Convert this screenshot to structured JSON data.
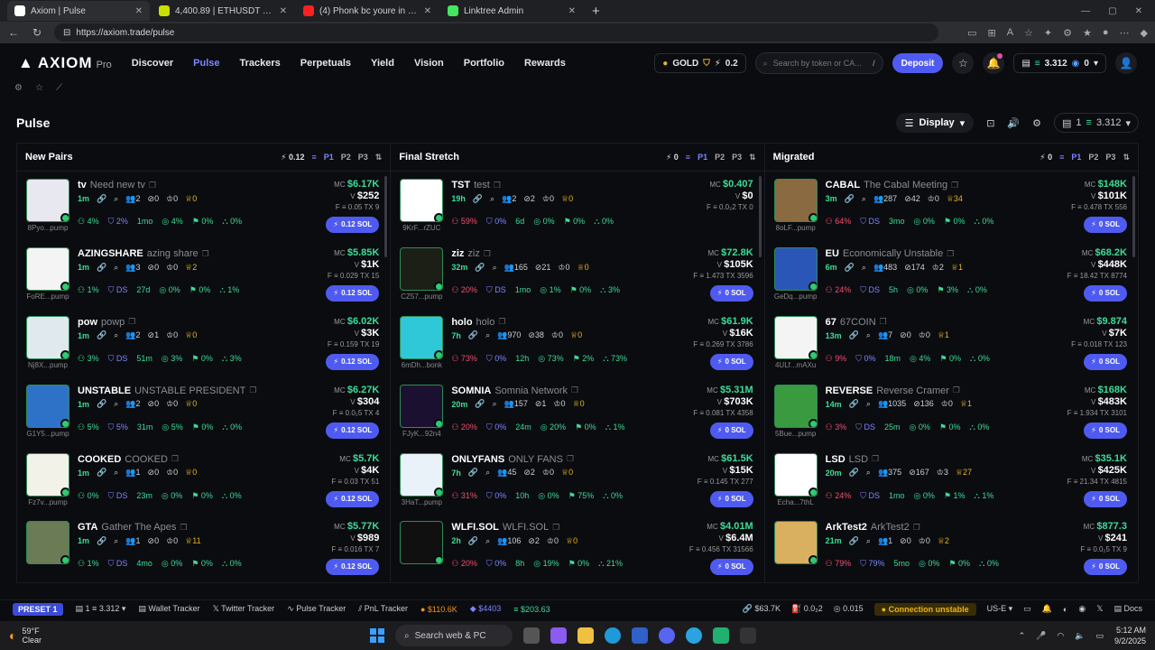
{
  "browser": {
    "tabs": [
      {
        "title": "Axiom | Pulse",
        "color": "#ffffff",
        "active": true
      },
      {
        "title": "4,400.89 | ETHUSDT Futures Exch",
        "color": "#c8e000",
        "active": false
      },
      {
        "title": "(4) Phonk bc youre in an ed",
        "color": "#ff2020",
        "active": false
      },
      {
        "title": "Linktree Admin",
        "color": "#43e660",
        "active": false
      }
    ],
    "url": "https://axiom.trade/pulse"
  },
  "nav": {
    "logo": "AXIOM",
    "logo_sub": "Pro",
    "links": [
      "Discover",
      "Pulse",
      "Trackers",
      "Perpetuals",
      "Yield",
      "Vision",
      "Portfolio",
      "Rewards"
    ],
    "active": "Pulse",
    "gold_label": "GOLD",
    "points": "0.2",
    "search_placeholder": "Search by token or CA...",
    "search_key": "/",
    "deposit": "Deposit",
    "balance": "3.312",
    "usd_balance": "0"
  },
  "page": {
    "title": "Pulse",
    "display": "Display",
    "wallet_count": "1",
    "wallet_balance": "3.312"
  },
  "columns": [
    {
      "title": "New Pairs",
      "amount": "0.12",
      "tokens": [
        {
          "sym": "tv",
          "name": "Need new tv",
          "age": "1m",
          "s1": "2",
          "s2": "0",
          "s3": "0",
          "s4": "0",
          "addr": "8Pyo...pump",
          "mc": "$6.17K",
          "v": "$252",
          "f": "0.05",
          "tx": "9",
          "sol": "0.12 SOL",
          "p1": "4%",
          "p2": "2%",
          "p3": "1mo",
          "p4": "4%",
          "p5": "0%",
          "p6": "0%",
          "thumb": "#e8e8f0"
        },
        {
          "sym": "AZINGSHARE",
          "name": "azing share",
          "age": "1m",
          "s1": "3",
          "s2": "0",
          "s3": "0",
          "s4": "2",
          "addr": "FoRE...pump",
          "mc": "$5.85K",
          "v": "$1K",
          "f": "0.029",
          "tx": "15",
          "sol": "0.12 SOL",
          "p1": "1%",
          "p2": "DS",
          "p3": "27d",
          "p4": "0%",
          "p5": "0%",
          "p6": "1%",
          "thumb": "#f4f4f4"
        },
        {
          "sym": "pow",
          "name": "powp",
          "age": "1m",
          "s1": "2",
          "s2": "1",
          "s3": "0",
          "s4": "0",
          "addr": "Nj8X...pump",
          "mc": "$6.02K",
          "v": "$3K",
          "f": "0.159",
          "tx": "19",
          "sol": "0.12 SOL",
          "p1": "3%",
          "p2": "DS",
          "p3": "51m",
          "p4": "3%",
          "p5": "0%",
          "p6": "3%",
          "thumb": "#dfe9ee"
        },
        {
          "sym": "UNSTABLE",
          "name": "UNSTABLE PRESIDENT",
          "age": "1m",
          "s1": "2",
          "s2": "0",
          "s3": "0",
          "s4": "0",
          "addr": "G1Y5...pump",
          "mc": "$6.27K",
          "v": "$304",
          "f": "0.0₂5",
          "tx": "4",
          "sol": "0.12 SOL",
          "p1": "5%",
          "p2": "5%",
          "p3": "31m",
          "p4": "5%",
          "p5": "0%",
          "p6": "0%",
          "thumb": "#2e72c8"
        },
        {
          "sym": "COOKED",
          "name": "COOKED",
          "age": "1m",
          "s1": "1",
          "s2": "0",
          "s3": "0",
          "s4": "0",
          "addr": "Fz7v...pump",
          "mc": "$5.7K",
          "v": "$4K",
          "f": "0.03",
          "tx": "51",
          "sol": "0.12 SOL",
          "p1": "0%",
          "p2": "DS",
          "p3": "23m",
          "p4": "0%",
          "p5": "0%",
          "p6": "0%",
          "thumb": "#f2f2e8"
        },
        {
          "sym": "GTA",
          "name": "Gather The Apes",
          "age": "1m",
          "s1": "1",
          "s2": "0",
          "s3": "0",
          "s4": "11",
          "addr": "",
          "mc": "$5.77K",
          "v": "$989",
          "f": "0.016",
          "tx": "7",
          "sol": "0.12 SOL",
          "p1": "1%",
          "p2": "DS",
          "p3": "4mo",
          "p4": "0%",
          "p5": "0%",
          "p6": "0%",
          "thumb": "#6a7b55"
        }
      ]
    },
    {
      "title": "Final Stretch",
      "amount": "0",
      "tokens": [
        {
          "sym": "TST",
          "name": "test",
          "age": "19h",
          "s1": "2",
          "s2": "2",
          "s3": "0",
          "s4": "0",
          "addr": "9KrF...rZUC",
          "mc": "$0.407",
          "v": "$0",
          "f": "0.0₂2",
          "tx": "0",
          "sol": "",
          "p1": "59%",
          "p2": "0%",
          "p3": "6d",
          "p4": "0%",
          "p5": "0%",
          "p6": "0%",
          "thumb": "#ffffff"
        },
        {
          "sym": "ziz",
          "name": "ziz",
          "age": "32m",
          "s1": "165",
          "s2": "21",
          "s3": "0",
          "s4": "0",
          "addr": "CZ57...pump",
          "mc": "$72.8K",
          "v": "$105K",
          "f": "1.473",
          "tx": "3596",
          "sol": "0 SOL",
          "p1": "20%",
          "p2": "DS",
          "p3": "1mo",
          "p4": "1%",
          "p5": "0%",
          "p6": "3%",
          "thumb": "#1c1f16"
        },
        {
          "sym": "holo",
          "name": "holo",
          "age": "7h",
          "s1": "970",
          "s2": "38",
          "s3": "0",
          "s4": "0",
          "addr": "6mDh...bonk",
          "mc": "$61.9K",
          "v": "$16K",
          "f": "0.269",
          "tx": "3786",
          "sol": "0 SOL",
          "p1": "73%",
          "p2": "0%",
          "p3": "12h",
          "p4": "73%",
          "p5": "2%",
          "p6": "73%",
          "thumb": "#2fc8d8"
        },
        {
          "sym": "SOMNIA",
          "name": "Somnia Network",
          "age": "20m",
          "s1": "157",
          "s2": "1",
          "s3": "0",
          "s4": "0",
          "addr": "FJyK...92n4",
          "mc": "$5.31M",
          "v": "$703K",
          "f": "0.081",
          "tx": "4358",
          "sol": "0 SOL",
          "p1": "20%",
          "p2": "0%",
          "p3": "24m",
          "p4": "20%",
          "p5": "0%",
          "p6": "1%",
          "thumb": "#1c1030"
        },
        {
          "sym": "ONLYFANS",
          "name": "ONLY FANS",
          "age": "7h",
          "s1": "45",
          "s2": "2",
          "s3": "0",
          "s4": "0",
          "addr": "3HaT...pump",
          "mc": "$61.5K",
          "v": "$15K",
          "f": "0.145",
          "tx": "277",
          "sol": "0 SOL",
          "p1": "31%",
          "p2": "0%",
          "p3": "10h",
          "p4": "0%",
          "p5": "75%",
          "p6": "0%",
          "thumb": "#e8f2f8"
        },
        {
          "sym": "WLFI.SOL",
          "name": "WLFI.SOL",
          "age": "2h",
          "s1": "106",
          "s2": "2",
          "s3": "0",
          "s4": "0",
          "addr": "",
          "mc": "$4.01M",
          "v": "$6.4M",
          "f": "0.456",
          "tx": "31566",
          "sol": "0 SOL",
          "p1": "20%",
          "p2": "0%",
          "p3": "8h",
          "p4": "19%",
          "p5": "0%",
          "p6": "21%",
          "thumb": "#101010"
        }
      ]
    },
    {
      "title": "Migrated",
      "amount": "0",
      "tokens": [
        {
          "sym": "CABAL",
          "name": "The Cabal Meeting",
          "age": "3m",
          "s1": "287",
          "s2": "42",
          "s3": "0",
          "s4": "34",
          "addr": "8oLF...pump",
          "mc": "$148K",
          "v": "$101K",
          "f": "0.478",
          "tx": "556",
          "sol": "0 SOL",
          "p1": "64%",
          "p2": "DS",
          "p3": "3mo",
          "p4": "0%",
          "p5": "0%",
          "p6": "0%",
          "thumb": "#8a6a40"
        },
        {
          "sym": "EU",
          "name": "Economically Unstable",
          "age": "6m",
          "s1": "483",
          "s2": "174",
          "s3": "2",
          "s4": "1",
          "addr": "GeDq...pump",
          "mc": "$68.2K",
          "v": "$448K",
          "f": "18.42",
          "tx": "8774",
          "sol": "0 SOL",
          "p1": "24%",
          "p2": "DS",
          "p3": "5h",
          "p4": "0%",
          "p5": "3%",
          "p6": "0%",
          "thumb": "#2a56b8"
        },
        {
          "sym": "67",
          "name": "67COIN",
          "age": "13m",
          "s1": "7",
          "s2": "0",
          "s3": "0",
          "s4": "1",
          "addr": "4ULf...mAXu",
          "mc": "$9.874",
          "v": "$7K",
          "f": "0.018",
          "tx": "123",
          "sol": "0 SOL",
          "p1": "9%",
          "p2": "0%",
          "p3": "18m",
          "p4": "4%",
          "p5": "0%",
          "p6": "0%",
          "thumb": "#f4f4f4"
        },
        {
          "sym": "REVERSE",
          "name": "Reverse Cramer",
          "age": "14m",
          "s1": "1035",
          "s2": "136",
          "s3": "0",
          "s4": "1",
          "addr": "5Bue...pump",
          "mc": "$168K",
          "v": "$483K",
          "f": "1.934",
          "tx": "3101",
          "sol": "0 SOL",
          "p1": "3%",
          "p2": "DS",
          "p3": "25m",
          "p4": "0%",
          "p5": "0%",
          "p6": "0%",
          "thumb": "#3a9a40"
        },
        {
          "sym": "LSD",
          "name": "LSD",
          "age": "20m",
          "s1": "375",
          "s2": "167",
          "s3": "3",
          "s4": "27",
          "addr": "Echa...7thL",
          "mc": "$35.1K",
          "v": "$425K",
          "f": "21.34",
          "tx": "4815",
          "sol": "0 SOL",
          "p1": "24%",
          "p2": "DS",
          "p3": "1mo",
          "p4": "0%",
          "p5": "1%",
          "p6": "1%",
          "thumb": "#ffffff"
        },
        {
          "sym": "ArkTest2",
          "name": "ArkTest2",
          "age": "21m",
          "s1": "1",
          "s2": "0",
          "s3": "0",
          "s4": "2",
          "addr": "",
          "mc": "$877.3",
          "v": "$241",
          "f": "0.0₂5",
          "tx": "9",
          "sol": "0 SOL",
          "p1": "79%",
          "p2": "79%",
          "p3": "5mo",
          "p4": "0%",
          "p5": "0%",
          "p6": "0%",
          "thumb": "#d8b060"
        }
      ]
    }
  ],
  "statusbar": {
    "preset": "PRESET 1",
    "wallets": "1",
    "wallet_bal": "3.312",
    "items": [
      "Wallet Tracker",
      "Twitter Tracker",
      "Pulse Tracker",
      "PnL Tracker"
    ],
    "btc": "$110.6K",
    "eth": "$4403",
    "sol": "$203.63",
    "mc": "$63.7K",
    "gas": "0.0₂2",
    "fee": "0.015",
    "connection": "Connection unstable",
    "region": "US-E",
    "docs": "Docs"
  },
  "taskbar": {
    "temp": "59°F",
    "weather": "Clear",
    "search": "Search web & PC",
    "time": "5:12 AM",
    "date": "9/2/2025"
  }
}
